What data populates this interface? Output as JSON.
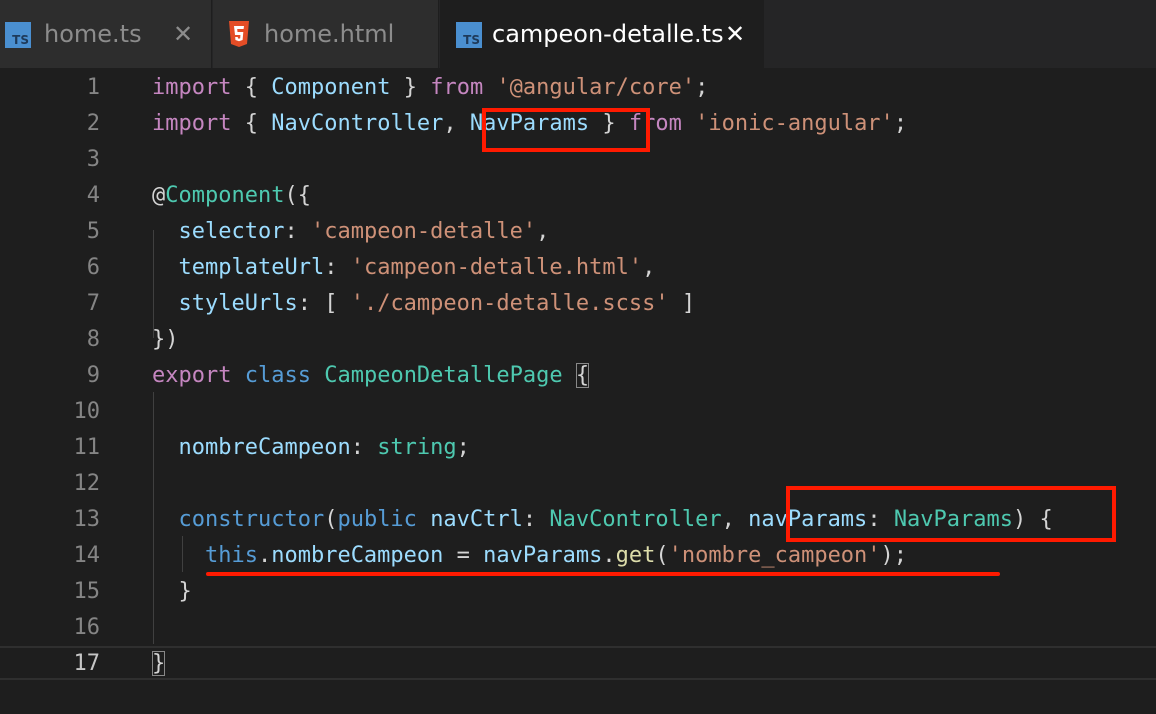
{
  "tabs": [
    {
      "label": "home.ts",
      "icon": "typescript-icon",
      "active": false
    },
    {
      "label": "home.html",
      "icon": "html5-icon",
      "active": false
    },
    {
      "label": "campeon-detalle.ts",
      "icon": "typescript-icon",
      "active": true
    }
  ],
  "close_glyph": "✕",
  "ts_badge": "TS",
  "line_numbers": [
    "1",
    "2",
    "3",
    "4",
    "5",
    "6",
    "7",
    "8",
    "9",
    "10",
    "11",
    "12",
    "13",
    "14",
    "15",
    "16",
    "17"
  ],
  "current_line": "17",
  "code": {
    "l1": {
      "a": "import",
      "b": " { ",
      "c": "Component",
      "d": " } ",
      "e": "from",
      "f": " ",
      "g": "'@angular/core'",
      "h": ";"
    },
    "l2": {
      "a": "import",
      "b": " { ",
      "c": "NavController",
      "d": ", ",
      "e": "NavParams",
      "f": " } ",
      "g": "from",
      "h": " ",
      "i": "'ionic-angular'",
      "j": ";"
    },
    "l4": {
      "a": "@",
      "b": "Component",
      "c": "({"
    },
    "l5": {
      "a": "  ",
      "b": "selector",
      "c": ": ",
      "d": "'campeon-detalle'",
      "e": ","
    },
    "l6": {
      "a": "  ",
      "b": "templateUrl",
      "c": ": ",
      "d": "'campeon-detalle.html'",
      "e": ","
    },
    "l7": {
      "a": "  ",
      "b": "styleUrls",
      "c": ": [ ",
      "d": "'./campeon-detalle.scss'",
      "e": " ]"
    },
    "l8": {
      "a": "})"
    },
    "l9": {
      "a": "export",
      "b": " ",
      "c": "class",
      "d": " ",
      "e": "CampeonDetallePage",
      "f": " ",
      "g": "{"
    },
    "l11": {
      "a": "  ",
      "b": "nombreCampeon",
      "c": ": ",
      "d": "string",
      "e": ";"
    },
    "l13": {
      "a": "  ",
      "b": "constructor",
      "c": "(",
      "d": "public",
      "e": " ",
      "f": "navCtrl",
      "g": ": ",
      "h": "NavController",
      "i": ", ",
      "j": "navParams",
      "k": ": ",
      "l": "NavParams",
      "m": ") {"
    },
    "l14": {
      "a": "    ",
      "b": "this",
      "c": ".",
      "d": "nombreCampeon",
      "e": " = ",
      "f": "navParams",
      "g": ".",
      "h": "get",
      "i": "(",
      "j": "'nombre_campeon'",
      "k": ");"
    },
    "l15": {
      "a": "  }"
    },
    "l17": {
      "a": "}"
    }
  },
  "colors": {
    "annotation": "#ff1a00",
    "keyword_control": "#c586c0",
    "keyword": "#569cd6",
    "type": "#4ec9b0",
    "variable": "#9cdcfe",
    "string": "#ce9178",
    "function": "#dcdcaa"
  }
}
